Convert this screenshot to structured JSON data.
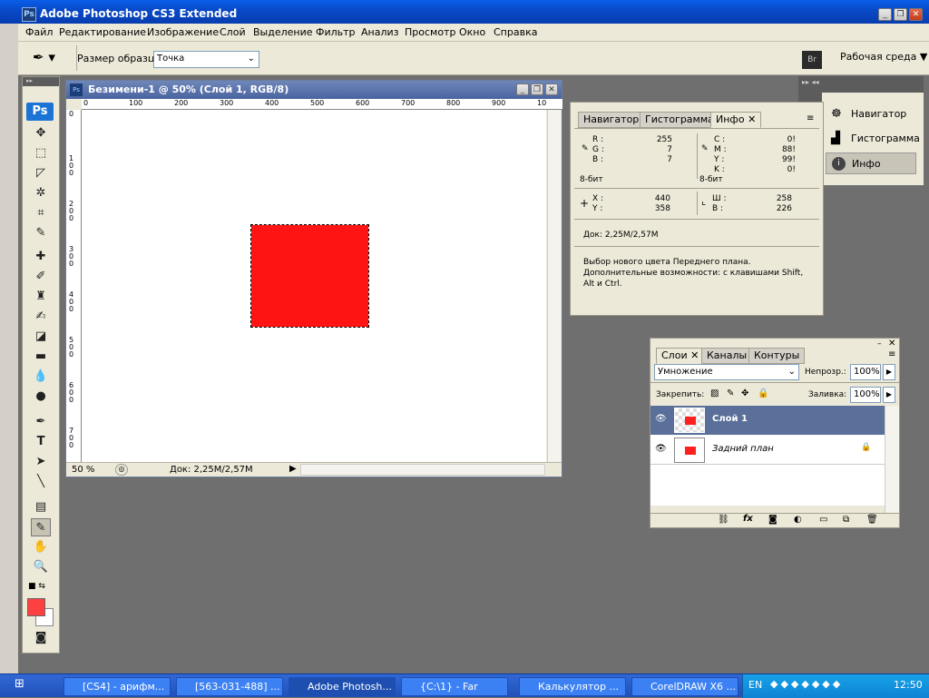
{
  "app": {
    "logo_text": "Ps",
    "title": "Adobe Photoshop CS3 Extended",
    "window_buttons": [
      "minimize",
      "restore",
      "close"
    ]
  },
  "menu": {
    "items": [
      "Файл",
      "Редактирование",
      "Изображение",
      "Слой",
      "Выделение",
      "Фильтр",
      "Анализ",
      "Просмотр",
      "Окно",
      "Справка"
    ]
  },
  "options_bar": {
    "sample_size_label": "Размер образца:",
    "sample_size_value": "Точка",
    "br_label": "Br",
    "workspace_label": "Рабочая среда"
  },
  "toolbox": {
    "badge": "Ps",
    "tools": [
      "move",
      "marquee",
      "lasso",
      "magic-wand",
      "crop",
      "eyedropper",
      "healing",
      "brush",
      "stamp",
      "history-brush",
      "eraser",
      "gradient",
      "blur",
      "dodge",
      "pen",
      "type",
      "path-select",
      "line",
      "notes",
      "eyedropper-active",
      "hand",
      "zoom"
    ],
    "foreground_color": "#ff4040",
    "background_color": "#ffffff"
  },
  "document": {
    "title": "Безимени-1 @ 50% (Слой 1, RGB/8)",
    "ruler_top": [
      "0",
      "100",
      "200",
      "300",
      "400",
      "500",
      "600",
      "700",
      "800",
      "900",
      "10"
    ],
    "ruler_left": [
      "0",
      "1 0 0",
      "2 0 0",
      "3 0 0",
      "4 0 0",
      "5 0 0",
      "6 0 0",
      "7 0 0"
    ],
    "zoom": "50 %",
    "doc_size": "Док: 2,25M/2,57M",
    "rect_color": "#ff1414"
  },
  "dock": {
    "items": [
      "Навигатор",
      "Гистограмма",
      "Инфо"
    ]
  },
  "info_panel": {
    "tabs": [
      "Навигатор",
      "Гистограмма",
      "Инфо"
    ],
    "rgb": {
      "r_label": "R :",
      "g_label": "G :",
      "b_label": "B :",
      "r": "255",
      "g": "7",
      "b": "7",
      "bit": "8-бит"
    },
    "cmyk": {
      "c_label": "C :",
      "m_label": "M :",
      "y_label": "Y :",
      "k_label": "K :",
      "c": "0!",
      "m": "88!",
      "y": "99!",
      "k": "0!",
      "bit": "8-бит"
    },
    "pos": {
      "x_label": "X :",
      "y_label": "Y :",
      "x": "440",
      "y": "358"
    },
    "size": {
      "w_label": "Ш :",
      "h_label": "В :",
      "w": "258",
      "h": "226"
    },
    "doc": "Док: 2,25M/2,57M",
    "hint_1": "Выбор нового цвета Переднего плана.",
    "hint_2": "Дополнительные возможности: с клавишами Shift,",
    "hint_3": "Alt и Ctrl."
  },
  "layers_panel": {
    "tabs": [
      "Слои",
      "Каналы",
      "Контуры"
    ],
    "blend_mode": "Умножение",
    "opacity_label": "Непрозр.:",
    "opacity": "100%",
    "lock_label": "Закрепить:",
    "fill_label": "Заливка:",
    "fill": "100%",
    "layers": [
      {
        "name": "Слой 1",
        "selected": true
      },
      {
        "name": "Задний план",
        "selected": false
      }
    ]
  },
  "taskbar": {
    "tasks": [
      "[CS4] - арифм...",
      "[563-031-488] ...",
      "Adobe Photosh...",
      "{C:\\1} - Far",
      "Калькулятор ...",
      "CorelDRAW X6 ..."
    ],
    "lang": "EN",
    "clock": "12:50"
  },
  "colors": {
    "titlebar": "#0848c6",
    "workspace": "#6f6f6f",
    "panel": "#ece9d8",
    "selected_layer": "#5a6f99"
  }
}
